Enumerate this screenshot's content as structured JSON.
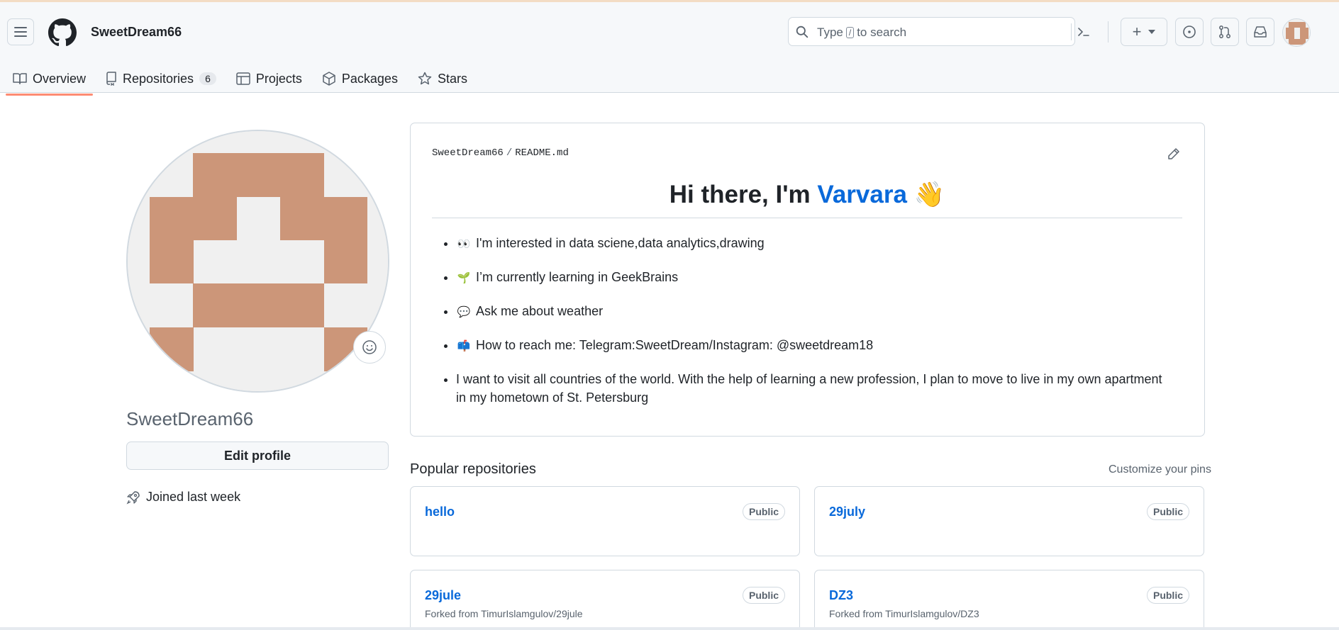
{
  "header": {
    "username": "SweetDream66",
    "search": {
      "prefix": "Type",
      "key": "/",
      "suffix": "to search"
    },
    "create_label": "+"
  },
  "tabs": [
    {
      "label": "Overview",
      "icon": "book-icon"
    },
    {
      "label": "Repositories",
      "icon": "repo-icon",
      "count": "6"
    },
    {
      "label": "Projects",
      "icon": "table-icon"
    },
    {
      "label": "Packages",
      "icon": "package-icon"
    },
    {
      "label": "Stars",
      "icon": "star-icon"
    }
  ],
  "profile": {
    "name": "SweetDream66",
    "edit_label": "Edit profile",
    "joined": "Joined last week",
    "avatar_color": "#cc9679"
  },
  "readme": {
    "owner": "SweetDream66",
    "file": "README.md",
    "heading_prefix": "Hi there, I'm",
    "heading_name": "Varvara",
    "heading_emoji": "👋",
    "items": [
      {
        "icon": "👀",
        "text": "I'm interested in data sciene,data analytics,drawing"
      },
      {
        "icon": "🌱",
        "text": "I’m currently learning in GeekBrains"
      },
      {
        "icon": "💬",
        "text": "Ask me about weather"
      },
      {
        "icon": "📫",
        "text": "How to reach me: Telegram:SweetDream/Instagram: @sweetdream18"
      },
      {
        "icon": "",
        "text": "I want to visit all countries of the world. With the help of learning a new profession, I plan to move to live in my own apartment in my hometown of St. Petersburg"
      }
    ]
  },
  "popular": {
    "title": "Popular repositories",
    "customize": "Customize your pins",
    "repos": [
      {
        "name": "hello",
        "visibility": "Public",
        "fork": ""
      },
      {
        "name": "29july",
        "visibility": "Public",
        "fork": ""
      },
      {
        "name": "29jule",
        "visibility": "Public",
        "fork": "Forked from TimurIslamgulov/29jule"
      },
      {
        "name": "DZ3",
        "visibility": "Public",
        "fork": "Forked from TimurIslamgulov/DZ3"
      }
    ]
  },
  "colors": {
    "accent": "#0969da",
    "tab_underline": "#fd8c73"
  }
}
